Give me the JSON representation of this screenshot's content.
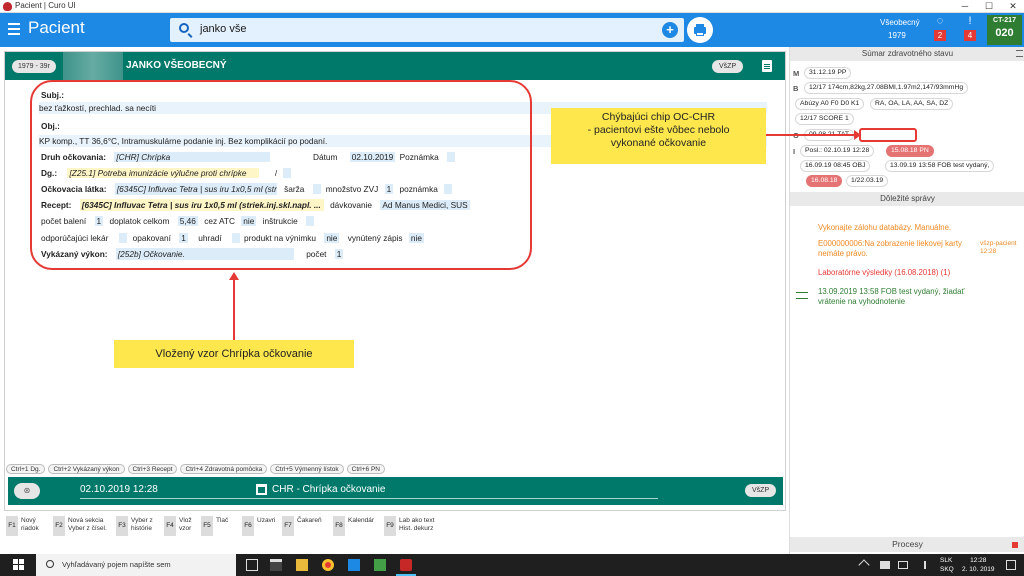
{
  "window": {
    "title": "Pacient | Curo UI",
    "min": "─",
    "max": "☐",
    "close": "✕"
  },
  "header": {
    "title": "Pacient",
    "search_value": "janko vše",
    "plus": "+",
    "patient_short": "Všeobecný",
    "patient_year": "1979",
    "badge1": "2",
    "badge2": "4",
    "ct_label": "CT-217",
    "ct_num": "020"
  },
  "patient": {
    "age_chip": "1979 - 39r",
    "name": "JANKO VŠEOBECNÝ",
    "insurer": "VšZP"
  },
  "record": {
    "subj_label": "Subj.:",
    "subj_text": "bez ťažkostí, prechlad. sa necíti",
    "obj_label": "Obj.:",
    "obj_text": "KP komp., TT 36,6°C, Intramuskulárne podanie inj. Bez komplikácií po podaní.",
    "druh_label": "Druh očkovania:",
    "druh_value": "[CHR] Chrípka",
    "datum_label": "Dátum",
    "datum_value": "02.10.2019",
    "poznamka_label": "Poznámka",
    "dg_label": "Dg.:",
    "dg_value": "[Z25.1] Potreba imunizácie výlučne proti chrípke",
    "slash": "/",
    "latka_label": "Očkovacia látka:",
    "latka_value": "[6345C] Influvac Tetra | sus iru 1x0,5 ml (striek.inj.skl.napl. ...",
    "sarza_label": "šarža",
    "mnozstvo_label": "množstvo ZVJ",
    "mnozstvo_value": "1",
    "poznamka2_label": "poznámka",
    "recept_label": "Recept:",
    "recept_value": "[6345C] Influvac Tetra | sus iru 1x0,5 ml (striek.inj.skl.napl. ...",
    "davkovanie_label": "dávkovanie",
    "davkovanie_value": "Ad Manus Medici, SUS",
    "pocet_baleni_label": "počet balení",
    "pocet_baleni_value": "1",
    "doplatok_label": "doplatok celkom",
    "doplatok_value": "5,46",
    "cez_atc_label": "cez ATC",
    "cez_atc_value": "nie",
    "instrukcie_label": "inštrukcie",
    "odporucajuci_label": "odporúčajúci lekár",
    "opakovani_label": "opakovaní",
    "opakovani_value": "1",
    "uhradi_label": "uhradí",
    "vynimku_label": "produkt na výnimku",
    "vynimku_value": "nie",
    "zapis_label": "vynútený zápis",
    "zapis_value": "nie",
    "vykon_label": "Vykázaný výkon:",
    "vykon_value": "[252b] Očkovanie.",
    "pocet_label": "počet",
    "pocet_value": "1"
  },
  "shortcuts": [
    "Ctrl+1 Dg.",
    "Ctrl+2 Vykázaný výkon",
    "Ctrl+3 Recept",
    "Ctrl+4 Zdravotná pomôcka",
    "Ctrl+5 Výmenný lístok",
    "Ctrl+6 PN"
  ],
  "visit": {
    "date": "02.10.2019 12:28",
    "type": "CHR - Chrípka očkovanie",
    "insurer": "VšZP"
  },
  "fkeys": [
    {
      "key": "F1",
      "desc": "Nový\nriadok"
    },
    {
      "key": "F2",
      "desc": "Nová sekcia\nVyber z čísel."
    },
    {
      "key": "F3",
      "desc": "Vyber z\nhistórie"
    },
    {
      "key": "F4",
      "desc": "Vlož\nvzor"
    },
    {
      "key": "F5",
      "desc": "Tlač"
    },
    {
      "key": "F6",
      "desc": "Uzavri"
    },
    {
      "key": "F7",
      "desc": "Čakareň"
    },
    {
      "key": "F8",
      "desc": "Kalendár"
    },
    {
      "key": "F9",
      "desc": "Lab ako text\nHist. dekurz"
    }
  ],
  "summary": {
    "title": "Súmar zdravotného stavu",
    "m_label": "M",
    "m_value": "31.12.19 PP",
    "b_label": "B",
    "b_value": "12/17 174cm,82kg,27.08BMI,1.97m2,147/93mmHg",
    "abuzy": "Abúzy A0 F0 D0 K1",
    "ra": "RA, OA, LA, AA, SA, DZ",
    "score": "12/17 SCORE 1",
    "o_label": "O",
    "o_value": "09.08.21 TAT",
    "i_label": "I",
    "posl": "Posl.: 02.10.19 12:28",
    "pn": "15.08.18 PN",
    "obj": "16.09.19 08:45 OBJ",
    "fob": "13.09.19 13:58 FOB test vydaný,",
    "date_red": "16.08.18",
    "date_last": "1/22.03.19"
  },
  "important": {
    "title": "Dôležité správy",
    "msg1": "Vykonajte zálohu databázy. Manuálne.",
    "msg2": "E000000006:Na zobrazenie liekovej karty nemáte právo.",
    "msg2_meta": "všzp-pacient 12:28",
    "msg3": "Laboratórne výsledky (16.08.2018) (1)",
    "msg4": "13.09.2019 13:58 FOB test vydaný, žiadať vrátenie na vyhodnotenie"
  },
  "procesy": "Procesy",
  "callout1": {
    "line1": "Chýbajúci chip OC-CHR",
    "line2": "- pacientovi ešte vôbec nebolo",
    "line3": "vykonané očkovanie"
  },
  "callout2": "Vložený vzor Chrípka očkovanie",
  "taskbar": {
    "search_placeholder": "Vyhľadávaný pojem napíšte sem",
    "lang": "SLK",
    "lang2": "SKQ",
    "time": "12:28",
    "date": "2. 10. 2019"
  },
  "colors": {
    "primary": "#1e88e5",
    "teal": "#00796b",
    "accent_red": "#e53935",
    "callout": "#fde74c"
  }
}
